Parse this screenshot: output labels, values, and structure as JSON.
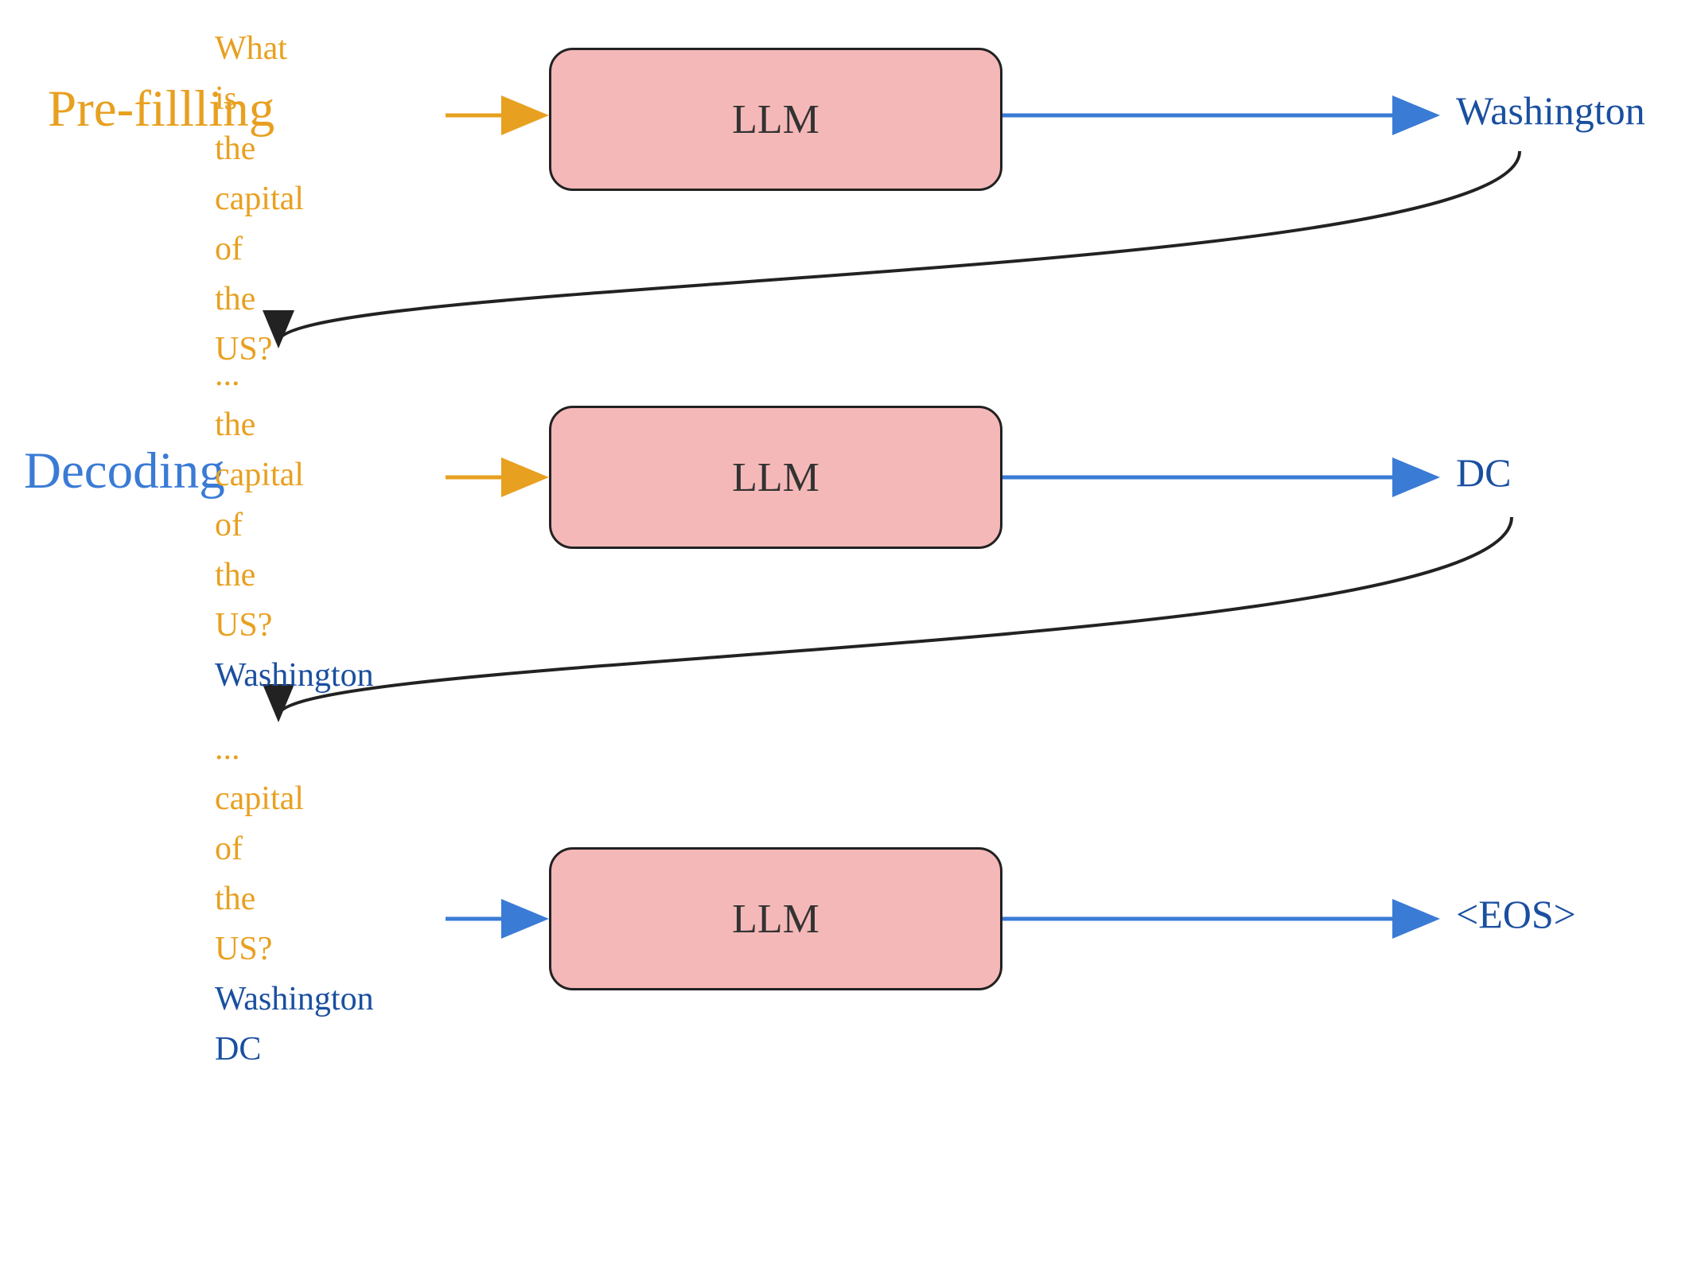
{
  "prefilling": {
    "section_label": "Pre-fillling",
    "input_lines": [
      "What",
      "is",
      "the",
      "capital",
      "of",
      "the",
      "US?"
    ],
    "llm_label": "LLM",
    "output": "Washington"
  },
  "decoding1": {
    "section_label": "Decoding",
    "input_lines": [
      "...",
      "the",
      "capital",
      "of",
      "the",
      "US?",
      "Washington"
    ],
    "llm_label": "LLM",
    "output": "DC"
  },
  "decoding2": {
    "input_lines": [
      "...",
      "capital",
      "of",
      "the",
      "US?",
      "Washington",
      "DC"
    ],
    "llm_label": "LLM",
    "output": "<EOS>"
  },
  "colors": {
    "orange": "#e8a020",
    "blue": "#3a7bd5",
    "dark_blue": "#1a4fa0",
    "llm_bg": "#f5b8b8",
    "border": "#222"
  }
}
